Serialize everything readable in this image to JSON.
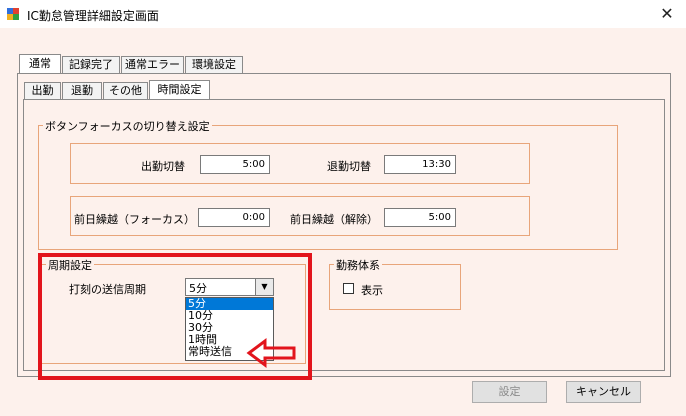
{
  "window": {
    "title": "IC勤怠管理詳細設定画面",
    "close_glyph": "✕"
  },
  "tabs": [
    "通常",
    "記録完了",
    "通常エラー",
    "環境設定"
  ],
  "subtabs": [
    "出勤",
    "退勤",
    "その他",
    "時間設定"
  ],
  "focus_group": {
    "legend": "ボタンフォーカスの切り替え設定",
    "row1": {
      "label_a": "出勤切替",
      "value_a": "5:00",
      "label_b": "退勤切替",
      "value_b": "13:30"
    },
    "row2": {
      "label_a": "前日繰越（フォーカス）",
      "value_a": "0:00",
      "label_b": "前日繰越（解除）",
      "value_b": "5:00"
    }
  },
  "cycle_group": {
    "legend": "周期設定",
    "label": "打刻の送信周期",
    "selected": "5分",
    "arrow_glyph": "▼",
    "options": [
      "5分",
      "10分",
      "30分",
      "1時間",
      "常時送信"
    ]
  },
  "work_group": {
    "legend": "勤務体系",
    "checkbox_label": "表示",
    "checked": false
  },
  "buttons": {
    "settei": "設定",
    "cancel": "キャンセル"
  },
  "annotation": {
    "color": "#e2141c"
  }
}
